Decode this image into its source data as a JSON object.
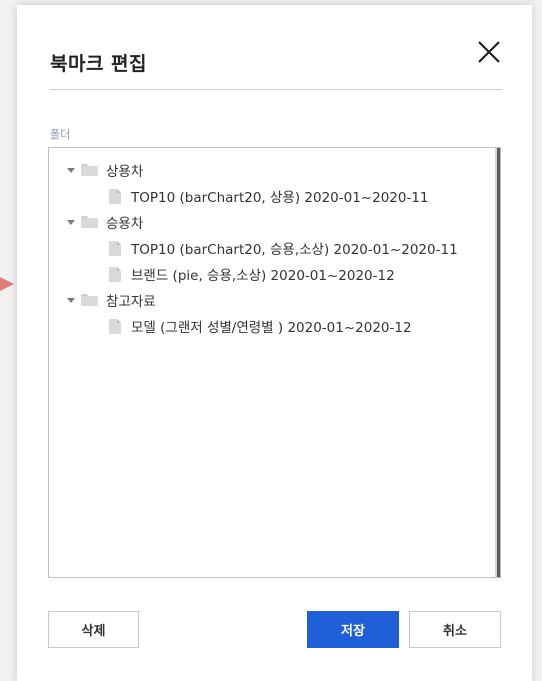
{
  "dialog": {
    "title": "북마크 편집",
    "close_icon": "close-icon"
  },
  "folder_field": {
    "label": "폴더"
  },
  "tree": [
    {
      "type": "folder",
      "label": "상용차",
      "expanded": true,
      "children": [
        {
          "type": "file",
          "label": "TOP10 (barChart20, 상용) 2020-01~2020-11"
        }
      ]
    },
    {
      "type": "folder",
      "label": "승용차",
      "expanded": true,
      "children": [
        {
          "type": "file",
          "label": "TOP10 (barChart20, 승용,소상) 2020-01~2020-11"
        },
        {
          "type": "file",
          "label": "브랜드 (pie, 승용,소상) 2020-01~2020-12"
        }
      ]
    },
    {
      "type": "folder",
      "label": "참고자료",
      "expanded": true,
      "children": [
        {
          "type": "file",
          "label": "모델 (그랜저 성별/연령별 ) 2020-01~2020-12"
        }
      ]
    }
  ],
  "buttons": {
    "delete_label": "삭제",
    "save_label": "저장",
    "cancel_label": "취소"
  },
  "colors": {
    "primary": "#1f5fd8",
    "backdrop": "#f2f2f2",
    "indicator_arrow": "#e07b7b",
    "label_muted": "#8a9ab5"
  }
}
